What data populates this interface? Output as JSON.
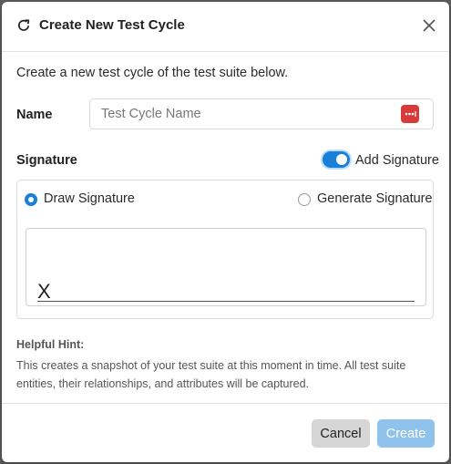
{
  "dialog": {
    "title": "Create New Test Cycle",
    "intro": "Create a new test cycle of the test suite below."
  },
  "name_field": {
    "label": "Name",
    "placeholder": "Test Cycle Name",
    "value": ""
  },
  "signature": {
    "label": "Signature",
    "toggle_label": "Add Signature",
    "toggle_on": true,
    "options": [
      {
        "label": "Draw Signature",
        "selected": true
      },
      {
        "label": "Generate Signature",
        "selected": false
      }
    ],
    "pad_mark": "X"
  },
  "hint": {
    "title": "Helpful Hint:",
    "text": "This creates a snapshot of your test suite at this moment in time. All test suite entities, their relationships, and attributes will be captured."
  },
  "footer": {
    "cancel_label": "Cancel",
    "create_label": "Create"
  },
  "colors": {
    "accent": "#1a7fd8",
    "create_disabled": "#8fc3ec",
    "cancel_bg": "#d6d6d6",
    "password_manager": "#d83a3a"
  },
  "icons": {
    "title_icon": "refresh-icon",
    "close_icon": "close-icon",
    "password_manager_icon": "password-manager-icon"
  }
}
